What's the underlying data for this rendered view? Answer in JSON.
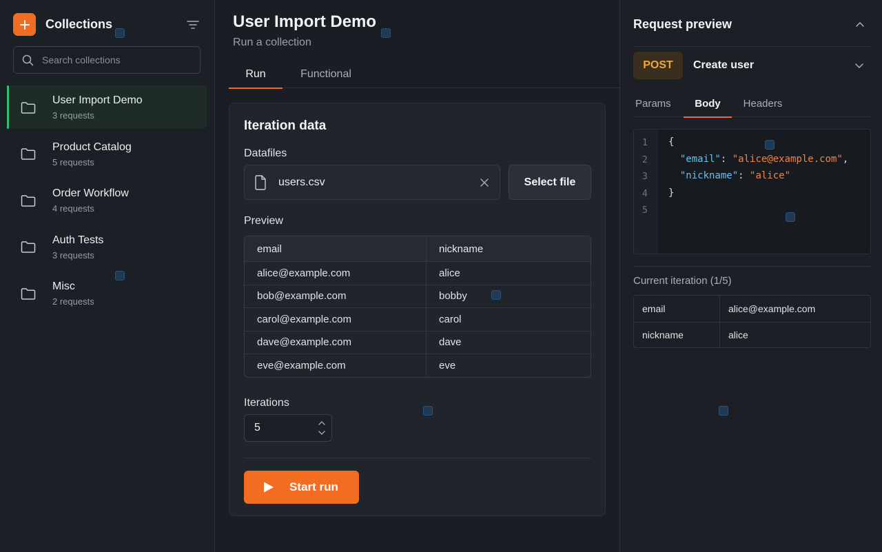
{
  "sidebar": {
    "title": "Collections",
    "search": {
      "placeholder": "Search collections",
      "value": ""
    },
    "collections": [
      {
        "name": "User Import Demo",
        "count": "3 requests",
        "active": true
      },
      {
        "name": "Product Catalog",
        "count": "5 requests",
        "active": false
      },
      {
        "name": "Order Workflow",
        "count": "4 requests",
        "active": false
      },
      {
        "name": "Auth Tests",
        "count": "3 requests",
        "active": false
      },
      {
        "name": "Misc",
        "count": "2 requests",
        "active": false
      }
    ]
  },
  "main": {
    "title": "User Import Demo",
    "subtitle": "Run a collection",
    "tabs": [
      {
        "label": "Run",
        "active": true
      },
      {
        "label": "Functional",
        "active": false
      }
    ],
    "card": {
      "title": "Iteration data",
      "datafiles_label": "Datafiles",
      "file_name": "users.csv",
      "select_file_label": "Select file",
      "preview_label": "Preview",
      "preview_headers": [
        "email",
        "nickname"
      ],
      "preview_rows": [
        [
          "alice@example.com",
          "alice"
        ],
        [
          "bob@example.com",
          "bobby"
        ],
        [
          "carol@example.com",
          "carol"
        ],
        [
          "dave@example.com",
          "dave"
        ],
        [
          "eve@example.com",
          "eve"
        ]
      ],
      "iterations_label": "Iterations",
      "iterations_value": "5",
      "start_label": "Start run"
    }
  },
  "request_preview": {
    "title": "Request preview",
    "method": "POST",
    "request_name": "Create user",
    "tabs": [
      {
        "label": "Params",
        "active": false
      },
      {
        "label": "Body",
        "active": true
      },
      {
        "label": "Headers",
        "active": false
      }
    ],
    "line_numbers": [
      "1",
      "2",
      "3",
      "4",
      "5"
    ],
    "body": {
      "open": "{",
      "key1": "\"email\"",
      "val1": "\"alice@example.com\"",
      "key2": "\"nickname\"",
      "val2": "\"alice\"",
      "close": "}"
    },
    "current_iteration_label": "Current iteration (1/5)",
    "current_iteration": [
      [
        "email",
        "alice@example.com"
      ],
      [
        "nickname",
        "alice"
      ]
    ]
  },
  "colors": {
    "accent": "#f26d21",
    "active_marker": "#2fbf71",
    "method_post": "#f0a73a",
    "json_key": "#6cc0e8",
    "json_string": "#f0834a"
  },
  "icons": {
    "add": "plus-icon",
    "filter": "filter-icon",
    "search": "search-icon",
    "folder": "folder-icon",
    "file": "file-icon",
    "clear": "close-icon",
    "play": "play-icon",
    "collapse": "chevron-up-icon",
    "expand": "chevron-down-icon"
  }
}
